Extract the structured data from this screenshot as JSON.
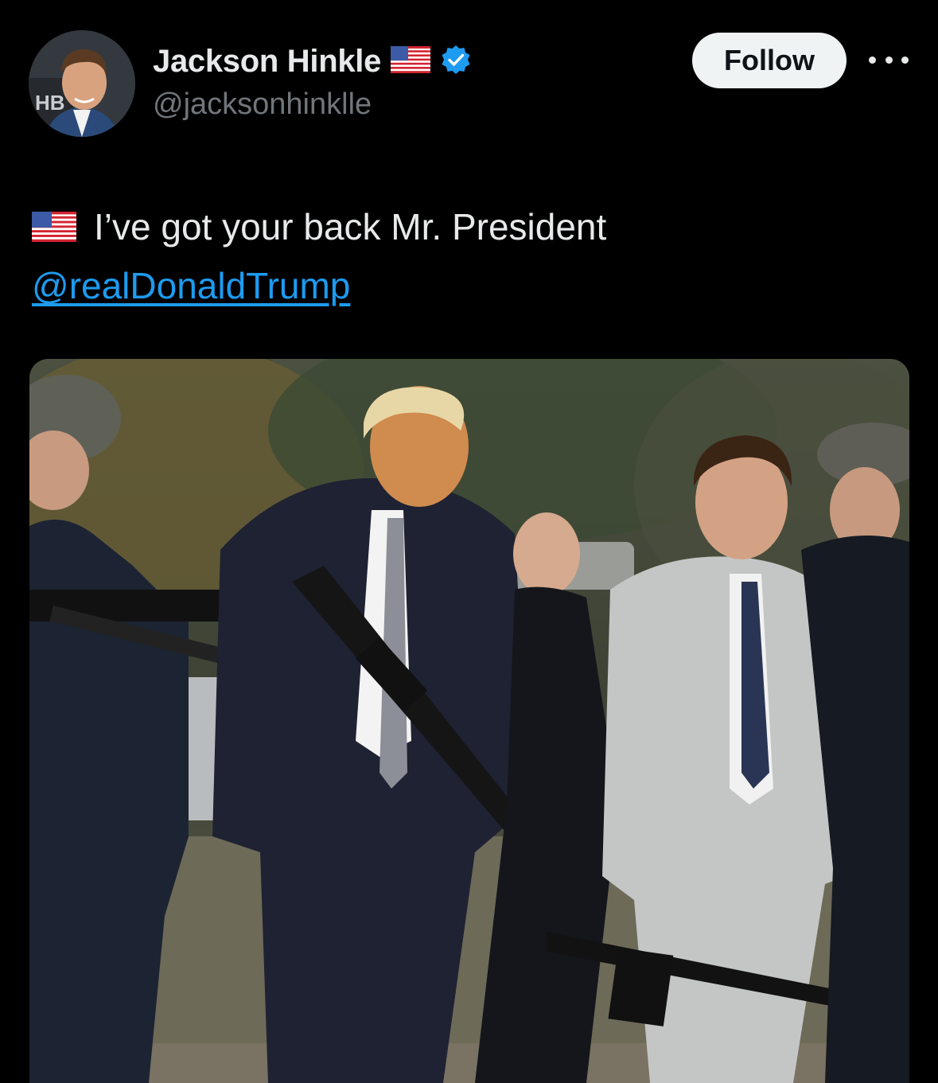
{
  "author": {
    "display_name": "Jackson Hinkle",
    "handle": "@jacksonhinklle",
    "avatar_icon": "profile-photo",
    "avatar_badge_text": "HB",
    "flag_icon": "us-flag-icon",
    "verified_icon": "verified-badge-icon",
    "verified_color": "#1d9bf0"
  },
  "actions": {
    "follow_label": "Follow",
    "more_icon": "more-horizontal-icon"
  },
  "tweet": {
    "flag_icon": "us-flag-icon",
    "text": "I’ve got your back Mr. President",
    "mention": "@realDonaldTrump",
    "mention_color": "#1d9bf0"
  },
  "media": {
    "type": "photo"
  },
  "colors": {
    "background": "#000000",
    "text_primary": "#e7e9ea",
    "text_secondary": "#71767b",
    "button_bg": "#eff3f4",
    "button_text": "#0f1419"
  }
}
